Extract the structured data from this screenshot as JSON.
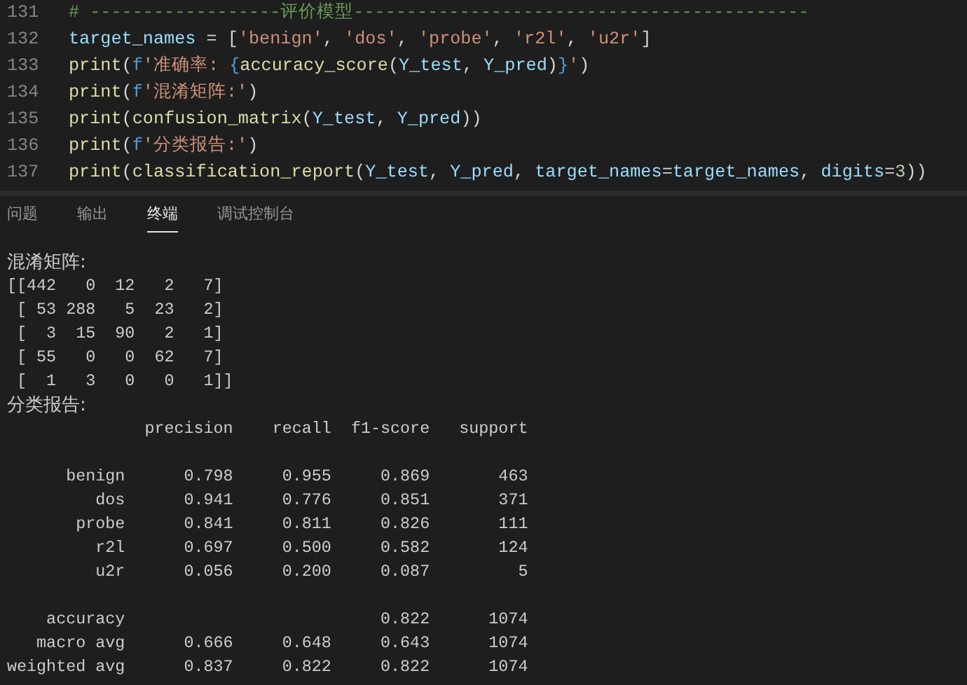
{
  "editor": {
    "lines": [
      {
        "number": "131",
        "tokens": [
          {
            "kind": "comment",
            "text": "# ------------------评价模型-------------------------------------------"
          }
        ]
      },
      {
        "number": "132",
        "tokens": [
          {
            "kind": "var",
            "text": "target_names"
          },
          {
            "kind": "plain",
            "text": " = ["
          },
          {
            "kind": "string",
            "text": "'benign'"
          },
          {
            "kind": "plain",
            "text": ", "
          },
          {
            "kind": "string",
            "text": "'dos'"
          },
          {
            "kind": "plain",
            "text": ", "
          },
          {
            "kind": "string",
            "text": "'probe'"
          },
          {
            "kind": "plain",
            "text": ", "
          },
          {
            "kind": "string",
            "text": "'r2l'"
          },
          {
            "kind": "plain",
            "text": ", "
          },
          {
            "kind": "string",
            "text": "'u2r'"
          },
          {
            "kind": "plain",
            "text": "]"
          }
        ]
      },
      {
        "number": "133",
        "tokens": [
          {
            "kind": "func",
            "text": "print"
          },
          {
            "kind": "plain",
            "text": "("
          },
          {
            "kind": "keyword",
            "text": "f"
          },
          {
            "kind": "string",
            "text": "'准确率: "
          },
          {
            "kind": "keyword",
            "text": "{"
          },
          {
            "kind": "func",
            "text": "accuracy_score"
          },
          {
            "kind": "plain",
            "text": "("
          },
          {
            "kind": "var",
            "text": "Y_test"
          },
          {
            "kind": "plain",
            "text": ", "
          },
          {
            "kind": "var",
            "text": "Y_pred"
          },
          {
            "kind": "plain",
            "text": ")"
          },
          {
            "kind": "keyword",
            "text": "}"
          },
          {
            "kind": "string",
            "text": "'"
          },
          {
            "kind": "plain",
            "text": ")"
          }
        ]
      },
      {
        "number": "134",
        "tokens": [
          {
            "kind": "func",
            "text": "print"
          },
          {
            "kind": "plain",
            "text": "("
          },
          {
            "kind": "keyword",
            "text": "f"
          },
          {
            "kind": "string",
            "text": "'混淆矩阵:'"
          },
          {
            "kind": "plain",
            "text": ")"
          }
        ]
      },
      {
        "number": "135",
        "tokens": [
          {
            "kind": "func",
            "text": "print"
          },
          {
            "kind": "plain",
            "text": "("
          },
          {
            "kind": "func",
            "text": "confusion_matrix"
          },
          {
            "kind": "plain",
            "text": "("
          },
          {
            "kind": "var",
            "text": "Y_test"
          },
          {
            "kind": "plain",
            "text": ", "
          },
          {
            "kind": "var",
            "text": "Y_pred"
          },
          {
            "kind": "plain",
            "text": "))"
          }
        ]
      },
      {
        "number": "136",
        "tokens": [
          {
            "kind": "func",
            "text": "print"
          },
          {
            "kind": "plain",
            "text": "("
          },
          {
            "kind": "keyword",
            "text": "f"
          },
          {
            "kind": "string",
            "text": "'分类报告:'"
          },
          {
            "kind": "plain",
            "text": ")"
          }
        ]
      },
      {
        "number": "137",
        "tokens": [
          {
            "kind": "func",
            "text": "print"
          },
          {
            "kind": "plain",
            "text": "("
          },
          {
            "kind": "func",
            "text": "classification_report"
          },
          {
            "kind": "plain",
            "text": "("
          },
          {
            "kind": "var",
            "text": "Y_test"
          },
          {
            "kind": "plain",
            "text": ", "
          },
          {
            "kind": "var",
            "text": "Y_pred"
          },
          {
            "kind": "plain",
            "text": ", "
          },
          {
            "kind": "var",
            "text": "target_names"
          },
          {
            "kind": "plain",
            "text": "="
          },
          {
            "kind": "var",
            "text": "target_names"
          },
          {
            "kind": "plain",
            "text": ", "
          },
          {
            "kind": "var",
            "text": "digits"
          },
          {
            "kind": "plain",
            "text": "="
          },
          {
            "kind": "number",
            "text": "3"
          },
          {
            "kind": "plain",
            "text": "))"
          }
        ]
      }
    ]
  },
  "panel_tabs": [
    {
      "label": "问题",
      "selected": false
    },
    {
      "label": "输出",
      "selected": false
    },
    {
      "label": "终端",
      "selected": true
    },
    {
      "label": "调试控制台",
      "selected": false
    }
  ],
  "terminal": {
    "lines": [
      {
        "kind": "output",
        "text": "混淆矩阵:"
      },
      {
        "kind": "output",
        "text": "[[442   0  12   2   7]"
      },
      {
        "kind": "output",
        "text": " [ 53 288   5  23   2]"
      },
      {
        "kind": "output",
        "text": " [  3  15  90   2   1]"
      },
      {
        "kind": "output",
        "text": " [ 55   0   0  62   7]"
      },
      {
        "kind": "output",
        "text": " [  1   3   0   0   1]]"
      },
      {
        "kind": "output",
        "text": "分类报告:"
      },
      {
        "kind": "output",
        "text": "              precision    recall  f1-score   support"
      },
      {
        "kind": "gap"
      },
      {
        "kind": "output",
        "text": "      benign      0.798     0.955     0.869       463"
      },
      {
        "kind": "output",
        "text": "         dos      0.941     0.776     0.851       371"
      },
      {
        "kind": "output",
        "text": "       probe      0.841     0.811     0.826       111"
      },
      {
        "kind": "output",
        "text": "         r2l      0.697     0.500     0.582       124"
      },
      {
        "kind": "output",
        "text": "         u2r      0.056     0.200     0.087         5"
      },
      {
        "kind": "gap"
      },
      {
        "kind": "output",
        "text": "    accuracy                          0.822      1074"
      },
      {
        "kind": "output",
        "text": "   macro avg      0.666     0.648     0.643      1074"
      },
      {
        "kind": "output",
        "text": "weighted avg      0.837     0.822     0.822      1074"
      }
    ]
  }
}
